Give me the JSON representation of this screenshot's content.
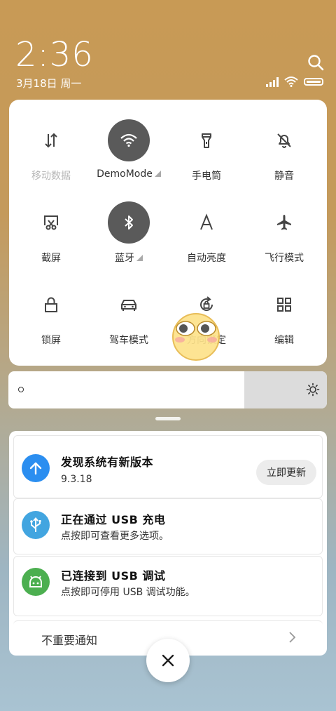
{
  "status_bar": {
    "time": "2:36",
    "date": "3月18日 周一",
    "icons": [
      "search-icon",
      "signal-icon",
      "wifi-icon",
      "battery-icon"
    ]
  },
  "quick_settings": {
    "tiles": [
      {
        "label": "移动数据",
        "icon": "mobile-data-icon",
        "state": "disabled"
      },
      {
        "label": "DemoMode",
        "icon": "wifi-icon",
        "state": "on",
        "expandable": true
      },
      {
        "label": "手电筒",
        "icon": "flashlight-icon",
        "state": "off"
      },
      {
        "label": "静音",
        "icon": "bell-off-icon",
        "state": "off"
      },
      {
        "label": "截屏",
        "icon": "screenshot-icon",
        "state": "off"
      },
      {
        "label": "蓝牙",
        "icon": "bluetooth-icon",
        "state": "on",
        "expandable": true
      },
      {
        "label": "自动亮度",
        "icon": "auto-brightness-icon",
        "state": "off"
      },
      {
        "label": "飞行模式",
        "icon": "airplane-icon",
        "state": "off"
      },
      {
        "label": "锁屏",
        "icon": "lock-icon",
        "state": "off"
      },
      {
        "label": "驾车模式",
        "icon": "car-icon",
        "state": "off"
      },
      {
        "label": "方向锁定",
        "icon": "rotation-lock-icon",
        "state": "off"
      },
      {
        "label": "编辑",
        "icon": "grid-edit-icon",
        "state": "off"
      }
    ]
  },
  "brightness": {
    "level": 0.74
  },
  "notifications": [
    {
      "title": "发现系统有新版本",
      "subtitle": "9.3.18",
      "action": "立即更新",
      "icon": "arrow-up-icon",
      "color": "#2b8ef0"
    },
    {
      "title": "正在通过 USB 充电",
      "subtitle": "点按即可查看更多选项。",
      "icon": "usb-icon",
      "color": "#42a5e0"
    },
    {
      "title": "已连接到 USB 调试",
      "subtitle": "点按即可停用 USB 调试功能。",
      "icon": "android-icon",
      "color": "#4caf50"
    }
  ],
  "minor_notifications": {
    "label": "不重要通知"
  },
  "colors": {
    "tile_on": "#5a5a5a",
    "panel": "#ffffff"
  }
}
